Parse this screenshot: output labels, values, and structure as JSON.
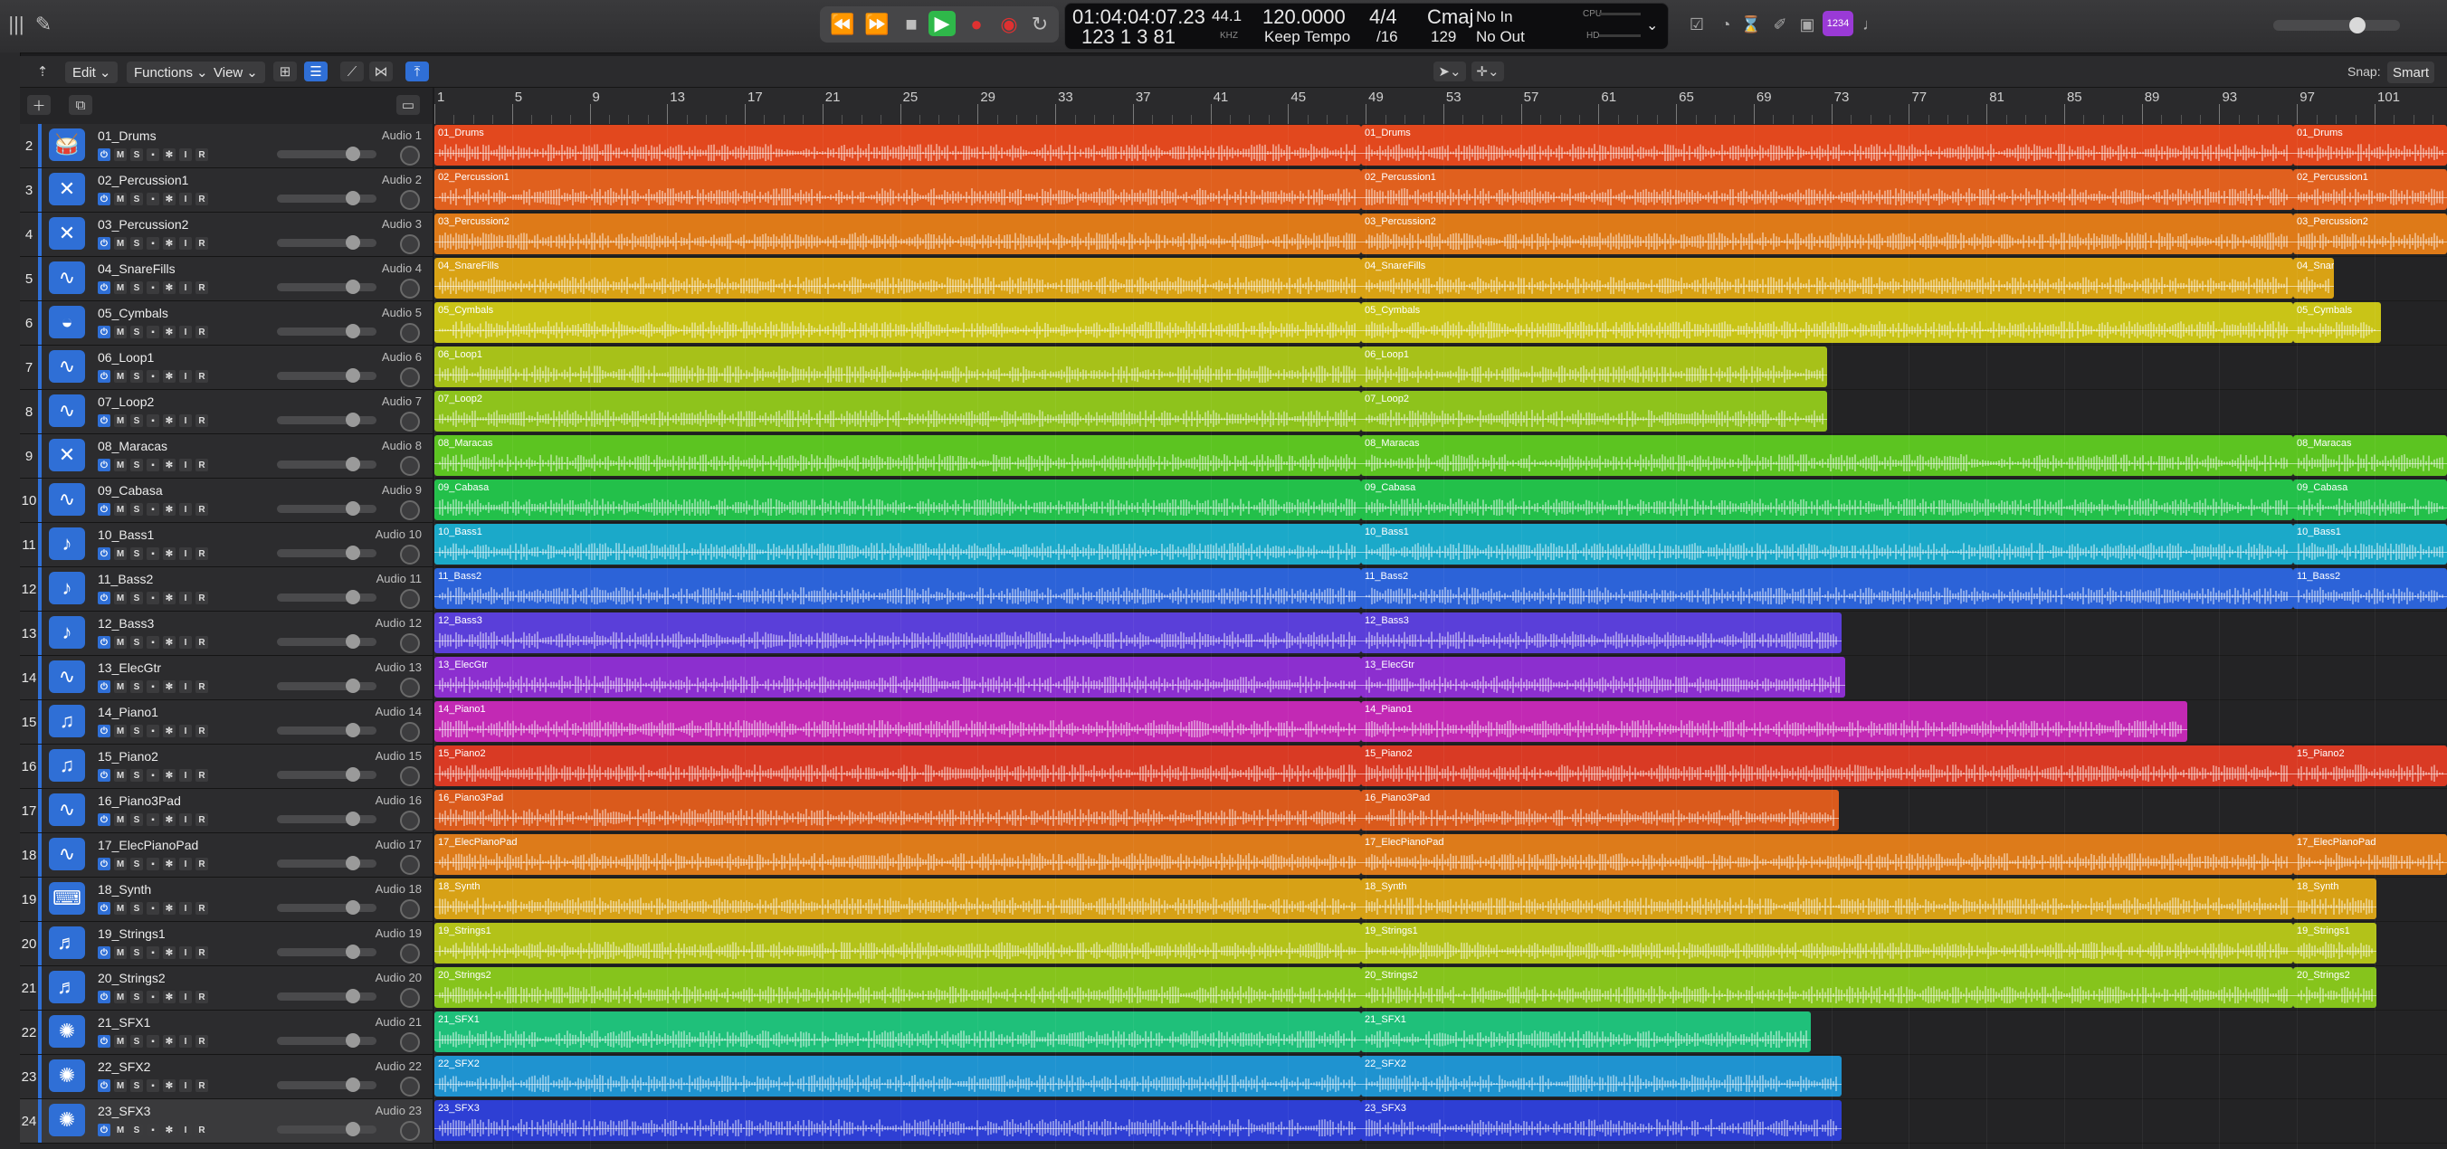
{
  "control_bar": {
    "lcd": {
      "time": "01:04:04:07.23",
      "bars": "123  1  3   81",
      "rate": "44.1",
      "rate_unit": "KHZ",
      "tempo": "120.0000",
      "tempo_mode": "Keep Tempo",
      "sig_top": "4/4",
      "sig_bottom": "/16",
      "key": "Cmaj",
      "key_value": "129",
      "in": "No In",
      "out": "No Out",
      "cpu_label": "CPU",
      "hd_label": "HD"
    },
    "counter_badge": "1234"
  },
  "toolbar": {
    "edit_label": "Edit",
    "functions_label": "Functions",
    "view_label": "View",
    "snap_label": "Snap:",
    "snap_value": "Smart"
  },
  "ruler_labels": [
    "1",
    "5",
    "9",
    "13",
    "17",
    "21",
    "25",
    "29",
    "33",
    "37",
    "41",
    "45",
    "49",
    "53",
    "57",
    "61",
    "65",
    "69",
    "73",
    "77",
    "81",
    "85",
    "89",
    "93",
    "97",
    "101",
    "1"
  ],
  "colors": {
    "accent": "#2f6fd6",
    "play_green": "#2fb84a",
    "record_red": "#e03131",
    "badge_purple": "#9a3ad6"
  },
  "tracks": [
    {
      "num": "2",
      "name": "01_Drums",
      "audio": "Audio 1",
      "color": "#e2481e",
      "icon": "drum-kit-icon",
      "knob": 0.76,
      "full": true,
      "end": 1
    },
    {
      "num": "3",
      "name": "02_Percussion1",
      "audio": "Audio 2",
      "color": "#e0601e",
      "icon": "sticks-icon",
      "knob": 0.76,
      "full": true,
      "end": 1
    },
    {
      "num": "4",
      "name": "03_Percussion2",
      "audio": "Audio 3",
      "color": "#de7a18",
      "icon": "sticks-icon",
      "knob": 0.76,
      "full": true,
      "end": 1
    },
    {
      "num": "5",
      "name": "04_SnareFills",
      "audio": "Audio 4",
      "color": "#d9a214",
      "icon": "waveform-icon",
      "knob": 0.76,
      "full": false,
      "end": 0.944
    },
    {
      "num": "6",
      "name": "05_Cymbals",
      "audio": "Audio 5",
      "color": "#c9c417",
      "icon": "cymbal-icon",
      "knob": 0.76,
      "full": false,
      "end": 0.967
    },
    {
      "num": "7",
      "name": "06_Loop1",
      "audio": "Audio 6",
      "color": "#a7c119",
      "icon": "waveform-icon",
      "knob": 0.76,
      "full": false,
      "end": 0.692
    },
    {
      "num": "8",
      "name": "07_Loop2",
      "audio": "Audio 7",
      "color": "#8ec31c",
      "icon": "waveform-icon",
      "knob": 0.76,
      "full": false,
      "end": 0.692
    },
    {
      "num": "9",
      "name": "08_Maracas",
      "audio": "Audio 8",
      "color": "#5cc421",
      "icon": "sticks-icon",
      "knob": 0.76,
      "full": true,
      "end": 1
    },
    {
      "num": "10",
      "name": "09_Cabasa",
      "audio": "Audio 9",
      "color": "#23c04a",
      "icon": "waveform-icon",
      "knob": 0.76,
      "full": true,
      "end": 1
    },
    {
      "num": "11",
      "name": "10_Bass1",
      "audio": "Audio 10",
      "color": "#1ba9c9",
      "icon": "guitar-icon",
      "knob": 0.76,
      "full": true,
      "end": 1
    },
    {
      "num": "12",
      "name": "11_Bass2",
      "audio": "Audio 11",
      "color": "#2c63d8",
      "icon": "guitar-icon",
      "knob": 0.76,
      "full": true,
      "end": 1
    },
    {
      "num": "13",
      "name": "12_Bass3",
      "audio": "Audio 12",
      "color": "#5a3fd9",
      "icon": "guitar-icon",
      "knob": 0.76,
      "full": false,
      "end": 0.699
    },
    {
      "num": "14",
      "name": "13_ElecGtr",
      "audio": "Audio 13",
      "color": "#8c2fcf",
      "icon": "waveform-icon",
      "knob": 0.76,
      "full": false,
      "end": 0.701
    },
    {
      "num": "15",
      "name": "14_Piano1",
      "audio": "Audio 14",
      "color": "#c229b4",
      "icon": "piano-icon",
      "knob": 0.76,
      "full": false,
      "end": 0.871
    },
    {
      "num": "16",
      "name": "15_Piano2",
      "audio": "Audio 15",
      "color": "#d93a24",
      "icon": "piano-icon",
      "knob": 0.76,
      "full": true,
      "end": 1
    },
    {
      "num": "17",
      "name": "16_Piano3Pad",
      "audio": "Audio 16",
      "color": "#da5a1c",
      "icon": "waveform-icon",
      "knob": 0.76,
      "full": false,
      "end": 0.698
    },
    {
      "num": "18",
      "name": "17_ElecPianoPad",
      "audio": "Audio 17",
      "color": "#dd7b1a",
      "icon": "waveform-icon",
      "knob": 0.76,
      "full": true,
      "end": 1
    },
    {
      "num": "19",
      "name": "18_Synth",
      "audio": "Audio 18",
      "color": "#d7a116",
      "icon": "keyboard-icon",
      "knob": 0.76,
      "full": false,
      "end": 0.965
    },
    {
      "num": "20",
      "name": "19_Strings1",
      "audio": "Audio 19",
      "color": "#b3c219",
      "icon": "strings-icon",
      "knob": 0.76,
      "full": false,
      "end": 0.965
    },
    {
      "num": "21",
      "name": "20_Strings2",
      "audio": "Audio 20",
      "color": "#86c41c",
      "icon": "strings-icon",
      "knob": 0.76,
      "full": false,
      "end": 0.965
    },
    {
      "num": "22",
      "name": "21_SFX1",
      "audio": "Audio 21",
      "color": "#1fc07a",
      "icon": "starburst-icon",
      "knob": 0.76,
      "full": false,
      "end": 0.684
    },
    {
      "num": "23",
      "name": "22_SFX2",
      "audio": "Audio 22",
      "color": "#1f93d0",
      "icon": "starburst-icon",
      "knob": 0.76,
      "full": false,
      "end": 0.699
    },
    {
      "num": "24",
      "name": "23_SFX3",
      "audio": "Audio 23",
      "color": "#2e3fd4",
      "icon": "starburst-icon",
      "knob": 0.76,
      "full": false,
      "end": 0.699
    }
  ]
}
